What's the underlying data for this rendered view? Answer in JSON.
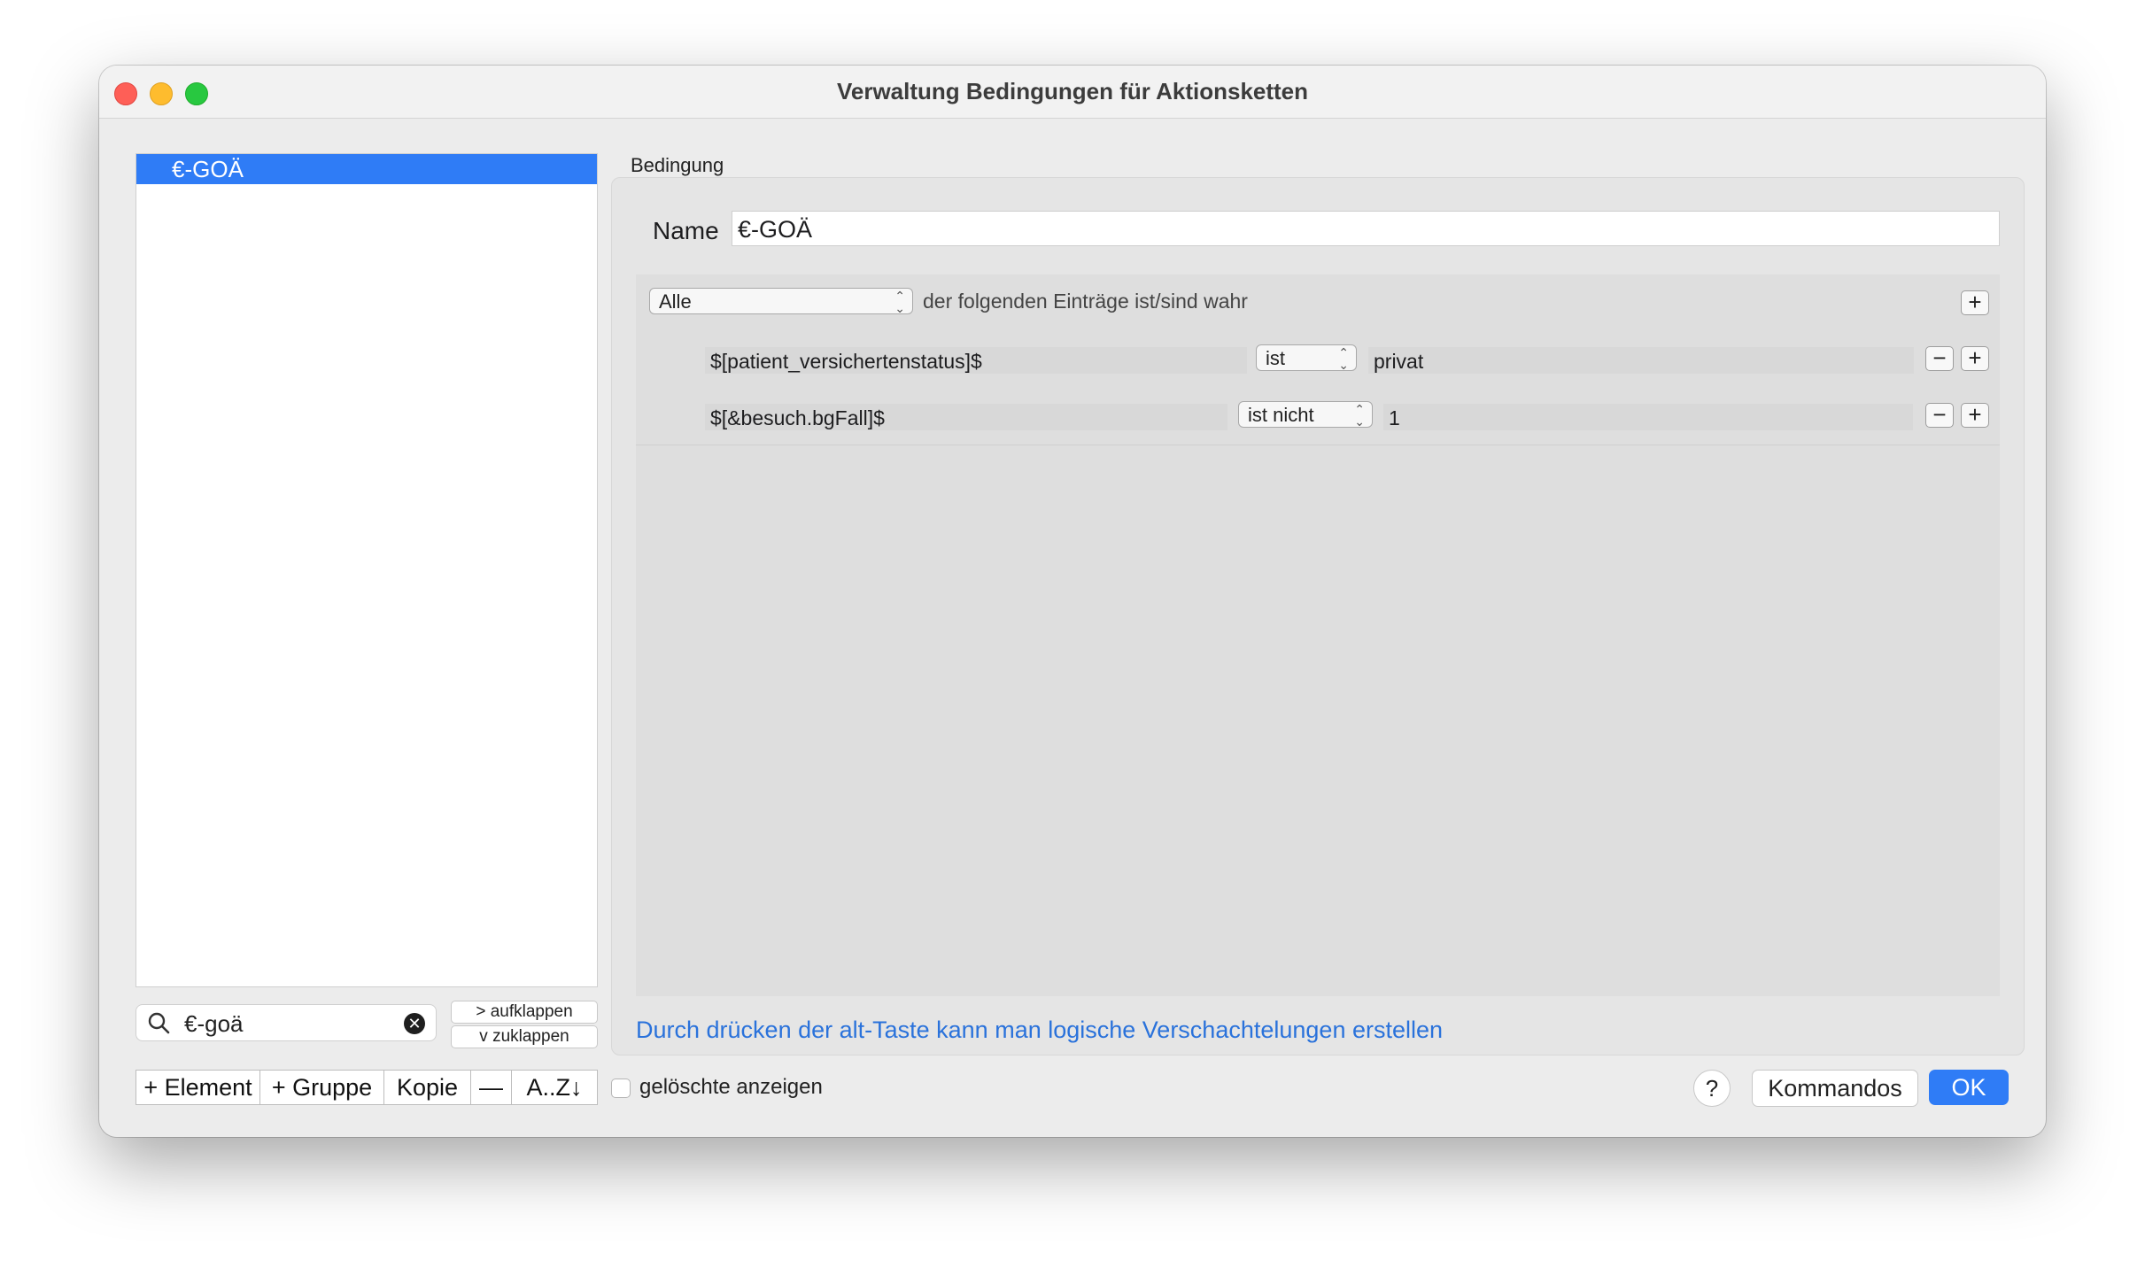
{
  "window": {
    "title": "Verwaltung Bedingungen für Aktionsketten"
  },
  "list": {
    "items": [
      {
        "label": "€-GOÄ",
        "selected": true
      }
    ]
  },
  "search": {
    "value": "€-goä"
  },
  "tree_buttons": {
    "expand": "> aufklappen",
    "collapse": "v  zuklappen"
  },
  "toolbar": {
    "add_element": "+ Element",
    "add_group": "+ Gruppe",
    "copy": "Kopie",
    "remove": "—",
    "sort": "A..Z↓"
  },
  "show_deleted": {
    "label": "gelöschte anzeigen",
    "checked": false
  },
  "condition": {
    "section_label": "Bedingung",
    "name_label": "Name",
    "name_value": "€-GOÄ",
    "match_mode": "Alle",
    "match_text": "der folgenden Einträge ist/sind wahr",
    "rules": [
      {
        "field": "$[patient_versichertenstatus]$",
        "operator": "ist",
        "value": "privat"
      },
      {
        "field": "$[&besuch.bgFall]$",
        "operator": "ist nicht",
        "value": "1"
      }
    ],
    "hint": "Durch drücken der alt-Taste kann man logische Verschachtelungen erstellen"
  },
  "footer": {
    "help": "?",
    "commands": "Kommandos",
    "ok": "OK"
  },
  "colors": {
    "accent": "#2f7cf6",
    "hint_link": "#2a72db"
  }
}
